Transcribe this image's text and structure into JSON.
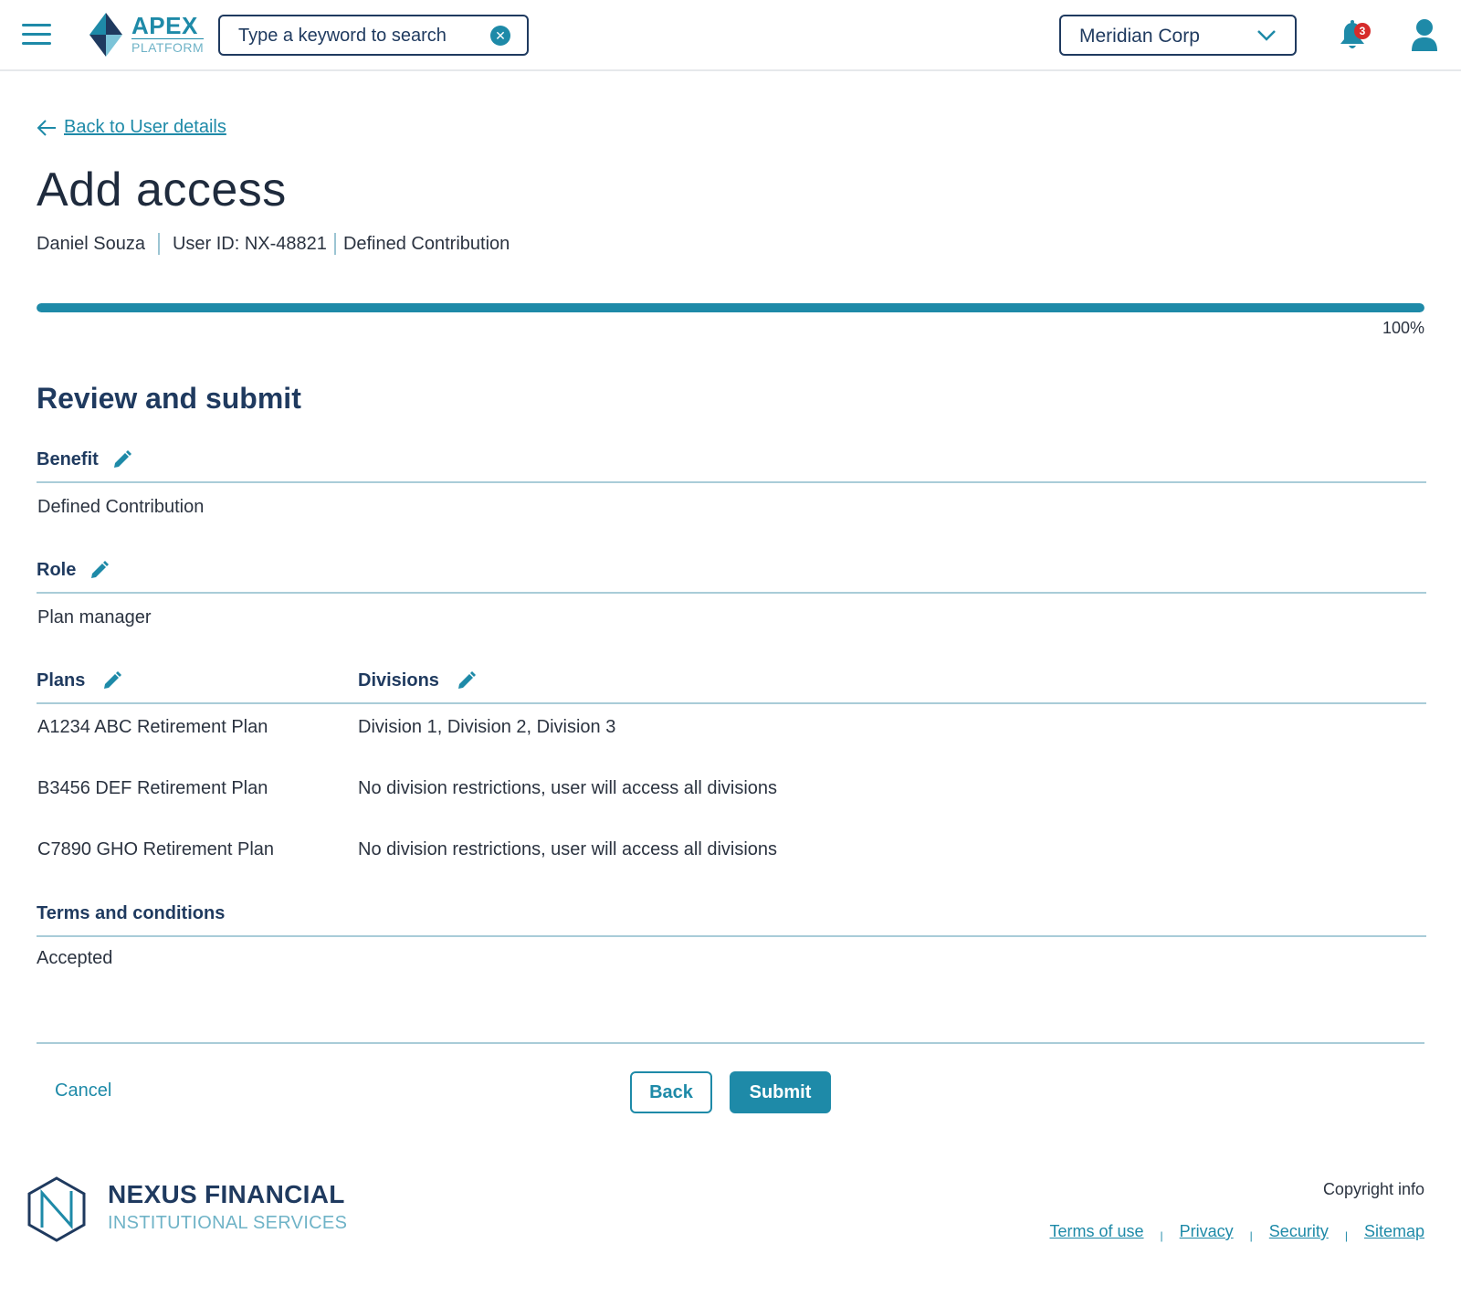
{
  "header": {
    "logo_title": "APEX",
    "logo_subtitle": "PLATFORM",
    "search_placeholder": "Type a keyword to search",
    "organization": "Meridian Corp",
    "notification_count": "3"
  },
  "back_link": "Back to User details",
  "page_title": "Add access",
  "user": {
    "name": "Daniel Souza",
    "user_id": "User ID: NX-48821",
    "benefit": "Defined Contribution"
  },
  "progress": {
    "percent": 100,
    "label": "100%"
  },
  "review": {
    "title": "Review and submit",
    "benefit_label": "Benefit",
    "benefit_value": "Defined Contribution",
    "role_label": "Role",
    "role_value": "Plan manager",
    "plans_label": "Plans",
    "divisions_label": "Divisions",
    "plans": [
      {
        "plan": "A1234 ABC Retirement Plan",
        "divisions": "Division 1, Division 2, Division 3"
      },
      {
        "plan": "B3456 DEF Retirement Plan",
        "divisions": "No division restrictions, user will access all divisions"
      },
      {
        "plan": "C7890 GHO Retirement Plan",
        "divisions": "No division restrictions, user will access all divisions"
      }
    ],
    "terms_label": "Terms and conditions",
    "terms_value": "Accepted"
  },
  "actions": {
    "cancel": "Cancel",
    "back": "Back",
    "submit": "Submit"
  },
  "footer": {
    "brand_line1": "NEXUS FINANCIAL",
    "brand_line2": "INSTITUTIONAL SERVICES",
    "copyright": "Copyright info",
    "links": [
      "Terms of use",
      "Privacy",
      "Security",
      "Sitemap"
    ]
  },
  "colors": {
    "accent": "#1e8aa8",
    "navy": "#1f3a5f",
    "badge": "#d62b2b"
  }
}
